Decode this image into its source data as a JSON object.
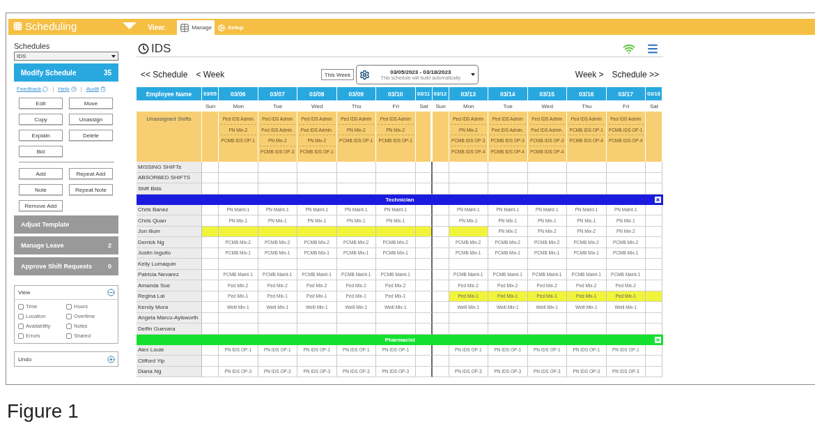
{
  "topbar": {
    "app_title": "Scheduling",
    "view_label": "View:",
    "tabs": [
      {
        "label": "Manage",
        "kind": "grid",
        "selected": true
      },
      {
        "label": "Setup",
        "kind": "cogs",
        "selected": false
      }
    ]
  },
  "sidebar": {
    "schedules_label": "Schedules",
    "schedule_select": "IDS",
    "modify": {
      "label": "Modify Schedule",
      "count": "35"
    },
    "links": [
      {
        "label": "Feedback",
        "kind": "chat"
      },
      {
        "label": "Help",
        "kind": "help"
      },
      {
        "label": "Audit",
        "kind": "clipboard"
      }
    ],
    "separator": "|",
    "buttons_top": [
      "Edit",
      "Move",
      "Copy",
      "Unassign",
      "Explain",
      "Delete",
      "Bid"
    ],
    "buttons_bottom": [
      "Add",
      "Repeat Add",
      "Note",
      "Repeat Note",
      "Remove Add"
    ],
    "actions": [
      {
        "label": "Adjust Template"
      },
      {
        "label": "Manage Leave",
        "count": "2"
      },
      {
        "label": "Approve Shift Requests",
        "count": "0"
      }
    ],
    "panels": [
      {
        "title": "View",
        "expanded": true,
        "options": [
          {
            "label": "Time",
            "checked": false
          },
          {
            "label": "Hours",
            "checked": false
          },
          {
            "label": "Location",
            "checked": false
          },
          {
            "label": "Overtime",
            "checked": false
          },
          {
            "label": "Availability",
            "checked": false
          },
          {
            "label": "Notes",
            "checked": false
          },
          {
            "label": "Errors",
            "checked": false
          },
          {
            "label": "Shared",
            "checked": false
          }
        ]
      },
      {
        "title": "Undo",
        "expanded": false
      }
    ]
  },
  "main": {
    "title": "IDS",
    "nav": {
      "prev_schedule": "<< Schedule",
      "prev_week": "< Week",
      "this_week": "This Week",
      "range": "03/05/2023 - 03/18/2023",
      "range_note": "This schedule will build automatically",
      "next_week": "Week >",
      "next_schedule": "Schedule >>"
    },
    "table": {
      "name_header": "Employee Name",
      "days": [
        {
          "date": "03/05",
          "day": "Sun"
        },
        {
          "date": "03/06",
          "day": "Mon"
        },
        {
          "date": "03/07",
          "day": "Tue"
        },
        {
          "date": "03/08",
          "day": "Wed"
        },
        {
          "date": "03/09",
          "day": "Thu"
        },
        {
          "date": "03/10",
          "day": "Fri"
        },
        {
          "date": "03/11",
          "day": "Sat"
        },
        {
          "date": "03/12",
          "day": "Sun"
        },
        {
          "date": "03/13",
          "day": "Mon"
        },
        {
          "date": "03/14",
          "day": "Tue"
        },
        {
          "date": "03/15",
          "day": "Wed"
        },
        {
          "date": "03/16",
          "day": "Thu"
        },
        {
          "date": "03/17",
          "day": "Fri"
        },
        {
          "date": "03/18",
          "day": "Sat"
        }
      ],
      "unassigned": {
        "label": "Unassigned Shifts",
        "cells": [
          {
            "kind": "empty"
          },
          {
            "kind": "shifts",
            "shifts": [
              "Ped IDS Admin",
              "PN Mix-2",
              "PCMB IDS OP-1"
            ]
          },
          {
            "kind": "shifts",
            "shifts": [
              "Ped IDS Admin",
              "Ped IDS Admin.",
              "PN Mix-2",
              "PCMB IDS OP-3"
            ]
          },
          {
            "kind": "shifts",
            "shifts": [
              "Ped IDS Admin",
              "Ped IDS Admin.",
              "PN Mix-2",
              "PCMB IDS OP-1"
            ]
          },
          {
            "kind": "shifts",
            "shifts": [
              "Ped IDS Admin",
              "PN Mix-2",
              "PCMB IDS OP-1"
            ]
          },
          {
            "kind": "shifts",
            "shifts": [
              "Ped IDS Admin",
              "PN Mix-2",
              "PCMB IDS OP-1"
            ]
          },
          {
            "kind": "empty"
          },
          {
            "kind": "empty"
          },
          {
            "kind": "shifts",
            "shifts": [
              "Ped IDS Admin",
              "PN Mix-2",
              "PCMB IDS OP-3",
              "PCMB IDS OP-4"
            ]
          },
          {
            "kind": "shifts",
            "shifts": [
              "Ped IDS Admin",
              "Ped IDS Admin.",
              "PCMB IDS OP-3",
              "PCMB IDS OP-4"
            ]
          },
          {
            "kind": "shifts",
            "shifts": [
              "Ped IDS Admin",
              "Ped IDS Admin.",
              "PCMB IDS OP-3",
              "PCMB IDS OP-4"
            ]
          },
          {
            "kind": "shifts",
            "shifts": [
              "Ped IDS Admin",
              "PCMB IDS OP-1",
              "PCMB IDS OP-4"
            ]
          },
          {
            "kind": "shifts",
            "shifts": [
              "Ped IDS Admin",
              "PCMB IDS OP-1",
              "PCMB IDS OP-4"
            ]
          },
          {
            "kind": "empty"
          }
        ]
      },
      "summary_rows": [
        "MISSING SHIFTs",
        "ABSORBED SHIFTS",
        "Shift Bids"
      ],
      "groups": [
        {
          "name": "Technician",
          "color": "#1b1be0",
          "employees": [
            {
              "name": "Chris Banez",
              "cells": [
                {
                  "kind": "empty",
                  "highlighted": false
                },
                {
                  "kind": "shift",
                  "text": "PN Maint-1",
                  "highlighted": false
                },
                {
                  "kind": "shift",
                  "text": "PN Maint-1",
                  "highlighted": false
                },
                {
                  "kind": "shift",
                  "text": "PN Maint-1",
                  "highlighted": false
                },
                {
                  "kind": "shift",
                  "text": "PN Maint-1",
                  "highlighted": false
                },
                {
                  "kind": "shift",
                  "text": "PN Maint-1",
                  "highlighted": false
                },
                {
                  "kind": "empty",
                  "highlighted": false
                },
                {
                  "kind": "empty",
                  "highlighted": false
                },
                {
                  "kind": "shift",
                  "text": "PN Maint-1",
                  "highlighted": false
                },
                {
                  "kind": "shift",
                  "text": "PN Maint-1",
                  "highlighted": false
                },
                {
                  "kind": "shift",
                  "text": "PN Maint-1",
                  "highlighted": false
                },
                {
                  "kind": "shift",
                  "text": "PN Maint-1",
                  "highlighted": false
                },
                {
                  "kind": "shift",
                  "text": "PN Maint-1",
                  "highlighted": false
                },
                {
                  "kind": "empty",
                  "highlighted": false
                }
              ]
            },
            {
              "name": "Chris Quan",
              "cells": [
                {
                  "kind": "empty",
                  "highlighted": false
                },
                {
                  "kind": "shift",
                  "text": "PN Mix-1",
                  "highlighted": false
                },
                {
                  "kind": "shift",
                  "text": "PN Mix-1",
                  "highlighted": false
                },
                {
                  "kind": "shift",
                  "text": "PN Mix-1",
                  "highlighted": false
                },
                {
                  "kind": "shift",
                  "text": "PN Mix-1",
                  "highlighted": false
                },
                {
                  "kind": "shift",
                  "text": "PN Mix-1",
                  "highlighted": false
                },
                {
                  "kind": "empty",
                  "highlighted": false
                },
                {
                  "kind": "empty",
                  "highlighted": false
                },
                {
                  "kind": "shift",
                  "text": "PN Mix-1",
                  "highlighted": false
                },
                {
                  "kind": "shift",
                  "text": "PN Mix-1",
                  "highlighted": false
                },
                {
                  "kind": "shift",
                  "text": "PN Mix-1",
                  "highlighted": false
                },
                {
                  "kind": "shift",
                  "text": "PN Mix-1",
                  "highlighted": false
                },
                {
                  "kind": "shift",
                  "text": "PN Mix-1",
                  "highlighted": false
                },
                {
                  "kind": "empty",
                  "highlighted": false
                }
              ]
            },
            {
              "name": "Jon Illum",
              "cells": [
                {
                  "kind": "empty",
                  "highlighted": true
                },
                {
                  "kind": "empty",
                  "highlighted": true
                },
                {
                  "kind": "empty",
                  "highlighted": true
                },
                {
                  "kind": "empty",
                  "highlighted": true
                },
                {
                  "kind": "empty",
                  "highlighted": true
                },
                {
                  "kind": "empty",
                  "highlighted": true
                },
                {
                  "kind": "empty",
                  "highlighted": true
                },
                {
                  "kind": "empty",
                  "highlighted": false
                },
                {
                  "kind": "empty",
                  "highlighted": true
                },
                {
                  "kind": "shift",
                  "text": "PN Mix-2",
                  "highlighted": false
                },
                {
                  "kind": "shift",
                  "text": "PN Mix-2",
                  "highlighted": false
                },
                {
                  "kind": "shift",
                  "text": "PN Mix-2",
                  "highlighted": false
                },
                {
                  "kind": "shift",
                  "text": "PN Mix-2",
                  "highlighted": false
                },
                {
                  "kind": "empty",
                  "highlighted": false
                }
              ]
            },
            {
              "name": "Derrick Ng",
              "cells": [
                {
                  "kind": "empty",
                  "highlighted": false
                },
                {
                  "kind": "shift",
                  "text": "PCMB Mix-2",
                  "highlighted": false
                },
                {
                  "kind": "shift",
                  "text": "PCMB Mix-2",
                  "highlighted": false
                },
                {
                  "kind": "shift",
                  "text": "PCMB Mix-2",
                  "highlighted": false
                },
                {
                  "kind": "shift",
                  "text": "PCMB Mix-2",
                  "highlighted": false
                },
                {
                  "kind": "shift",
                  "text": "PCMB Mix-2",
                  "highlighted": false
                },
                {
                  "kind": "empty",
                  "highlighted": false
                },
                {
                  "kind": "empty",
                  "highlighted": false
                },
                {
                  "kind": "shift",
                  "text": "PCMB Mix-2",
                  "highlighted": false
                },
                {
                  "kind": "shift",
                  "text": "PCMB Mix-2",
                  "highlighted": false
                },
                {
                  "kind": "shift",
                  "text": "PCMB Mix-2",
                  "highlighted": false
                },
                {
                  "kind": "shift",
                  "text": "PCMB Mix-2",
                  "highlighted": false
                },
                {
                  "kind": "shift",
                  "text": "PCMB Mix-2",
                  "highlighted": false
                },
                {
                  "kind": "empty",
                  "highlighted": false
                }
              ]
            },
            {
              "name": "Justin Inguito",
              "cells": [
                {
                  "kind": "empty",
                  "highlighted": false
                },
                {
                  "kind": "shift",
                  "text": "PCMB Mix-1",
                  "highlighted": false
                },
                {
                  "kind": "shift",
                  "text": "PCMB Mix-1",
                  "highlighted": false
                },
                {
                  "kind": "shift",
                  "text": "PCMB Mix-1",
                  "highlighted": false
                },
                {
                  "kind": "shift",
                  "text": "PCMB Mix-1",
                  "highlighted": false
                },
                {
                  "kind": "shift",
                  "text": "PCMB Mix-1",
                  "highlighted": false
                },
                {
                  "kind": "empty",
                  "highlighted": false
                },
                {
                  "kind": "empty",
                  "highlighted": false
                },
                {
                  "kind": "shift",
                  "text": "PCMB Mix-1",
                  "highlighted": false
                },
                {
                  "kind": "shift",
                  "text": "PCMB Mix-1",
                  "highlighted": false
                },
                {
                  "kind": "shift",
                  "text": "PCMB Mix-1",
                  "highlighted": false
                },
                {
                  "kind": "shift",
                  "text": "PCMB Mix-1",
                  "highlighted": false
                },
                {
                  "kind": "shift",
                  "text": "PCMB Mix-1",
                  "highlighted": false
                },
                {
                  "kind": "empty",
                  "highlighted": false
                }
              ]
            },
            {
              "name": "Kelly Lumaquin",
              "cells": [
                {
                  "kind": "empty",
                  "highlighted": false
                },
                {
                  "kind": "empty",
                  "highlighted": false
                },
                {
                  "kind": "empty",
                  "highlighted": false
                },
                {
                  "kind": "empty",
                  "highlighted": false
                },
                {
                  "kind": "empty",
                  "highlighted": false
                },
                {
                  "kind": "empty",
                  "highlighted": false
                },
                {
                  "kind": "empty",
                  "highlighted": false
                },
                {
                  "kind": "empty",
                  "highlighted": false
                },
                {
                  "kind": "empty",
                  "highlighted": false
                },
                {
                  "kind": "empty",
                  "highlighted": false
                },
                {
                  "kind": "empty",
                  "highlighted": false
                },
                {
                  "kind": "empty",
                  "highlighted": false
                },
                {
                  "kind": "empty",
                  "highlighted": false
                },
                {
                  "kind": "empty",
                  "highlighted": false
                }
              ]
            },
            {
              "name": "Patricia Nevarez",
              "cells": [
                {
                  "kind": "empty",
                  "highlighted": false
                },
                {
                  "kind": "shift",
                  "text": "PCMB Maint-1",
                  "highlighted": false
                },
                {
                  "kind": "shift",
                  "text": "PCMB Maint-1",
                  "highlighted": false
                },
                {
                  "kind": "shift",
                  "text": "PCMB Maint-1",
                  "highlighted": false
                },
                {
                  "kind": "shift",
                  "text": "PCMB Maint-1",
                  "highlighted": false
                },
                {
                  "kind": "shift",
                  "text": "PCMB Maint-1",
                  "highlighted": false
                },
                {
                  "kind": "empty",
                  "highlighted": false
                },
                {
                  "kind": "empty",
                  "highlighted": false
                },
                {
                  "kind": "shift",
                  "text": "PCMB Maint-1",
                  "highlighted": false
                },
                {
                  "kind": "shift",
                  "text": "PCMB Maint-1",
                  "highlighted": false
                },
                {
                  "kind": "shift",
                  "text": "PCMB Maint-1",
                  "highlighted": false
                },
                {
                  "kind": "shift",
                  "text": "PCMB Maint-1",
                  "highlighted": false
                },
                {
                  "kind": "shift",
                  "text": "PCMB Maint-1",
                  "highlighted": false
                },
                {
                  "kind": "empty",
                  "highlighted": false
                }
              ]
            },
            {
              "name": "Amanda Sue",
              "cells": [
                {
                  "kind": "empty",
                  "highlighted": false
                },
                {
                  "kind": "shift",
                  "text": "Ped Mix-2",
                  "highlighted": false
                },
                {
                  "kind": "shift",
                  "text": "Ped Mix-2",
                  "highlighted": false
                },
                {
                  "kind": "shift",
                  "text": "Ped Mix-2",
                  "highlighted": false
                },
                {
                  "kind": "shift",
                  "text": "Ped Mix-2",
                  "highlighted": false
                },
                {
                  "kind": "shift",
                  "text": "Ped Mix-2",
                  "highlighted": false
                },
                {
                  "kind": "empty",
                  "highlighted": false
                },
                {
                  "kind": "empty",
                  "highlighted": false
                },
                {
                  "kind": "shift",
                  "text": "Ped Mix-2",
                  "highlighted": false
                },
                {
                  "kind": "shift",
                  "text": "Ped Mix-2",
                  "highlighted": false
                },
                {
                  "kind": "shift",
                  "text": "Ped Mix-2",
                  "highlighted": false
                },
                {
                  "kind": "shift",
                  "text": "Ped Mix-2",
                  "highlighted": false
                },
                {
                  "kind": "shift",
                  "text": "Ped Mix-2",
                  "highlighted": false
                },
                {
                  "kind": "empty",
                  "highlighted": false
                }
              ]
            },
            {
              "name": "Regina Lai",
              "cells": [
                {
                  "kind": "empty",
                  "highlighted": false
                },
                {
                  "kind": "shift",
                  "text": "Ped Mix-1",
                  "highlighted": false
                },
                {
                  "kind": "shift",
                  "text": "Ped Mix-1",
                  "highlighted": false
                },
                {
                  "kind": "shift",
                  "text": "Ped Mix-1",
                  "highlighted": false
                },
                {
                  "kind": "shift",
                  "text": "Ped Mix-1",
                  "highlighted": false
                },
                {
                  "kind": "shift",
                  "text": "Ped Mix-1",
                  "highlighted": false
                },
                {
                  "kind": "empty",
                  "highlighted": false
                },
                {
                  "kind": "empty",
                  "highlighted": false
                },
                {
                  "kind": "shift",
                  "text": "Ped Mix-1",
                  "highlighted": true
                },
                {
                  "kind": "shift",
                  "text": "Ped Mix-1",
                  "highlighted": true
                },
                {
                  "kind": "shift",
                  "text": "Ped Mix-1",
                  "highlighted": true
                },
                {
                  "kind": "shift",
                  "text": "Ped Mix-1",
                  "highlighted": true
                },
                {
                  "kind": "shift",
                  "text": "Ped Mix-1",
                  "highlighted": true
                },
                {
                  "kind": "empty",
                  "highlighted": true
                }
              ]
            },
            {
              "name": "Kendy Mora",
              "cells": [
                {
                  "kind": "empty",
                  "highlighted": false
                },
                {
                  "kind": "shift",
                  "text": "Weill Mix-1",
                  "highlighted": false
                },
                {
                  "kind": "shift",
                  "text": "Weill Mix-1",
                  "highlighted": false
                },
                {
                  "kind": "shift",
                  "text": "Weill Mix-1",
                  "highlighted": false
                },
                {
                  "kind": "shift",
                  "text": "Weill Mix-1",
                  "highlighted": false
                },
                {
                  "kind": "shift",
                  "text": "Weill Mix-1",
                  "highlighted": false
                },
                {
                  "kind": "empty",
                  "highlighted": false
                },
                {
                  "kind": "empty",
                  "highlighted": false
                },
                {
                  "kind": "shift",
                  "text": "Weill Mix-1",
                  "highlighted": false
                },
                {
                  "kind": "shift",
                  "text": "Weill Mix-1",
                  "highlighted": false
                },
                {
                  "kind": "shift",
                  "text": "Weill Mix-1",
                  "highlighted": false
                },
                {
                  "kind": "shift",
                  "text": "Weill Mix-1",
                  "highlighted": false
                },
                {
                  "kind": "shift",
                  "text": "Weill Mix-1",
                  "highlighted": false
                },
                {
                  "kind": "empty",
                  "highlighted": false
                }
              ]
            },
            {
              "name": "Angela Marco-Aylsworth",
              "cells": [
                {
                  "kind": "empty",
                  "highlighted": false
                },
                {
                  "kind": "empty",
                  "highlighted": false
                },
                {
                  "kind": "empty",
                  "highlighted": false
                },
                {
                  "kind": "empty",
                  "highlighted": false
                },
                {
                  "kind": "empty",
                  "highlighted": false
                },
                {
                  "kind": "empty",
                  "highlighted": false
                },
                {
                  "kind": "empty",
                  "highlighted": false
                },
                {
                  "kind": "empty",
                  "highlighted": false
                },
                {
                  "kind": "empty",
                  "highlighted": false
                },
                {
                  "kind": "empty",
                  "highlighted": false
                },
                {
                  "kind": "empty",
                  "highlighted": false
                },
                {
                  "kind": "empty",
                  "highlighted": false
                },
                {
                  "kind": "empty",
                  "highlighted": false
                },
                {
                  "kind": "empty",
                  "highlighted": false
                }
              ]
            },
            {
              "name": "Delfin Guevara",
              "cells": [
                {
                  "kind": "empty",
                  "highlighted": false
                },
                {
                  "kind": "empty",
                  "highlighted": false
                },
                {
                  "kind": "empty",
                  "highlighted": false
                },
                {
                  "kind": "empty",
                  "highlighted": false
                },
                {
                  "kind": "empty",
                  "highlighted": false
                },
                {
                  "kind": "empty",
                  "highlighted": false
                },
                {
                  "kind": "empty",
                  "highlighted": false
                },
                {
                  "kind": "empty",
                  "highlighted": false
                },
                {
                  "kind": "empty",
                  "highlighted": false
                },
                {
                  "kind": "empty",
                  "highlighted": false
                },
                {
                  "kind": "empty",
                  "highlighted": false
                },
                {
                  "kind": "empty",
                  "highlighted": false
                },
                {
                  "kind": "empty",
                  "highlighted": false
                },
                {
                  "kind": "empty",
                  "highlighted": false
                }
              ]
            }
          ]
        },
        {
          "name": "Pharmacist",
          "color": "#14e030",
          "employees": [
            {
              "name": "Alex Louie",
              "cells": [
                {
                  "kind": "empty",
                  "highlighted": false
                },
                {
                  "kind": "shift",
                  "text": "PN IDS OP-1",
                  "highlighted": false
                },
                {
                  "kind": "shift",
                  "text": "PN IDS OP-1",
                  "highlighted": false
                },
                {
                  "kind": "shift",
                  "text": "PN IDS OP-1",
                  "highlighted": false
                },
                {
                  "kind": "shift",
                  "text": "PN IDS OP-1",
                  "highlighted": false
                },
                {
                  "kind": "shift",
                  "text": "PN IDS OP-1",
                  "highlighted": false
                },
                {
                  "kind": "empty",
                  "highlighted": false
                },
                {
                  "kind": "empty",
                  "highlighted": false
                },
                {
                  "kind": "shift",
                  "text": "PN IDS OP-1",
                  "highlighted": false
                },
                {
                  "kind": "shift",
                  "text": "PN IDS OP-1",
                  "highlighted": false
                },
                {
                  "kind": "shift",
                  "text": "PN IDS OP-1",
                  "highlighted": false
                },
                {
                  "kind": "shift",
                  "text": "PN IDS OP-1",
                  "highlighted": false
                },
                {
                  "kind": "shift",
                  "text": "PN IDS OP-1",
                  "highlighted": false
                },
                {
                  "kind": "empty",
                  "highlighted": false
                }
              ]
            },
            {
              "name": "Clifford Yip",
              "cells": [
                {
                  "kind": "empty",
                  "highlighted": false
                },
                {
                  "kind": "empty",
                  "highlighted": false
                },
                {
                  "kind": "empty",
                  "highlighted": false
                },
                {
                  "kind": "empty",
                  "highlighted": false
                },
                {
                  "kind": "empty",
                  "highlighted": false
                },
                {
                  "kind": "empty",
                  "highlighted": false
                },
                {
                  "kind": "empty",
                  "highlighted": false
                },
                {
                  "kind": "empty",
                  "highlighted": false
                },
                {
                  "kind": "empty",
                  "highlighted": false
                },
                {
                  "kind": "empty",
                  "highlighted": false
                },
                {
                  "kind": "empty",
                  "highlighted": false
                },
                {
                  "kind": "empty",
                  "highlighted": false
                },
                {
                  "kind": "empty",
                  "highlighted": false
                },
                {
                  "kind": "empty",
                  "highlighted": false
                }
              ]
            },
            {
              "name": "Diana Ng",
              "cells": [
                {
                  "kind": "empty",
                  "highlighted": false
                },
                {
                  "kind": "shift",
                  "text": "PN IDS OP-3",
                  "highlighted": false
                },
                {
                  "kind": "shift",
                  "text": "PN IDS OP-3",
                  "highlighted": false
                },
                {
                  "kind": "shift",
                  "text": "PN IDS OP-3",
                  "highlighted": false
                },
                {
                  "kind": "shift",
                  "text": "PN IDS OP-3",
                  "highlighted": false
                },
                {
                  "kind": "shift",
                  "text": "PN IDS OP-3",
                  "highlighted": false
                },
                {
                  "kind": "empty",
                  "highlighted": false
                },
                {
                  "kind": "empty",
                  "highlighted": false
                },
                {
                  "kind": "shift",
                  "text": "PN IDS OP-3",
                  "highlighted": false
                },
                {
                  "kind": "shift",
                  "text": "PN IDS OP-3",
                  "highlighted": false
                },
                {
                  "kind": "shift",
                  "text": "PN IDS OP-3",
                  "highlighted": false
                },
                {
                  "kind": "shift",
                  "text": "PN IDS OP-3",
                  "highlighted": false
                },
                {
                  "kind": "shift",
                  "text": "PN IDS OP-3",
                  "highlighted": false
                },
                {
                  "kind": "empty",
                  "highlighted": false
                }
              ]
            }
          ]
        }
      ]
    }
  },
  "caption": "Figure 1"
}
